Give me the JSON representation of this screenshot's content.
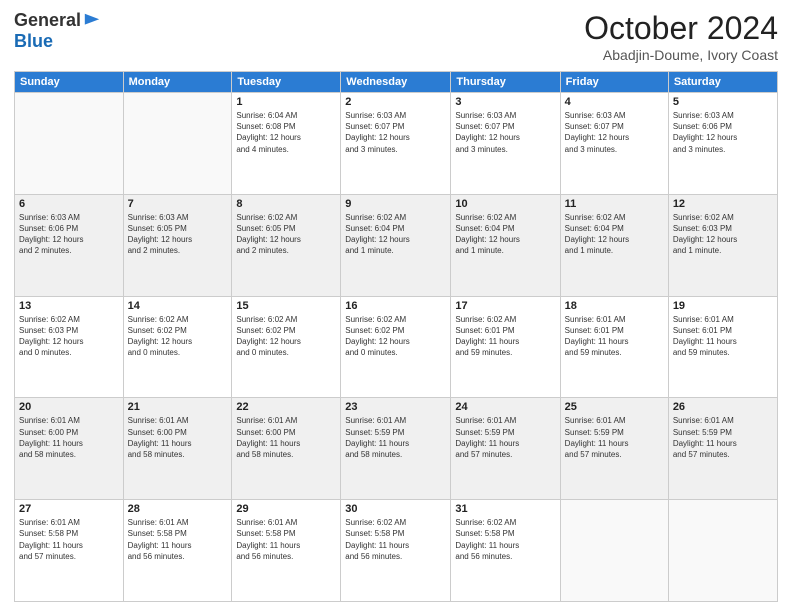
{
  "logo": {
    "general": "General",
    "blue": "Blue"
  },
  "header": {
    "month": "October 2024",
    "location": "Abadjin-Doume, Ivory Coast"
  },
  "weekdays": [
    "Sunday",
    "Monday",
    "Tuesday",
    "Wednesday",
    "Thursday",
    "Friday",
    "Saturday"
  ],
  "weeks": [
    [
      {
        "day": "",
        "info": ""
      },
      {
        "day": "",
        "info": ""
      },
      {
        "day": "1",
        "info": "Sunrise: 6:04 AM\nSunset: 6:08 PM\nDaylight: 12 hours\nand 4 minutes."
      },
      {
        "day": "2",
        "info": "Sunrise: 6:03 AM\nSunset: 6:07 PM\nDaylight: 12 hours\nand 3 minutes."
      },
      {
        "day": "3",
        "info": "Sunrise: 6:03 AM\nSunset: 6:07 PM\nDaylight: 12 hours\nand 3 minutes."
      },
      {
        "day": "4",
        "info": "Sunrise: 6:03 AM\nSunset: 6:07 PM\nDaylight: 12 hours\nand 3 minutes."
      },
      {
        "day": "5",
        "info": "Sunrise: 6:03 AM\nSunset: 6:06 PM\nDaylight: 12 hours\nand 3 minutes."
      }
    ],
    [
      {
        "day": "6",
        "info": "Sunrise: 6:03 AM\nSunset: 6:06 PM\nDaylight: 12 hours\nand 2 minutes."
      },
      {
        "day": "7",
        "info": "Sunrise: 6:03 AM\nSunset: 6:05 PM\nDaylight: 12 hours\nand 2 minutes."
      },
      {
        "day": "8",
        "info": "Sunrise: 6:02 AM\nSunset: 6:05 PM\nDaylight: 12 hours\nand 2 minutes."
      },
      {
        "day": "9",
        "info": "Sunrise: 6:02 AM\nSunset: 6:04 PM\nDaylight: 12 hours\nand 1 minute."
      },
      {
        "day": "10",
        "info": "Sunrise: 6:02 AM\nSunset: 6:04 PM\nDaylight: 12 hours\nand 1 minute."
      },
      {
        "day": "11",
        "info": "Sunrise: 6:02 AM\nSunset: 6:04 PM\nDaylight: 12 hours\nand 1 minute."
      },
      {
        "day": "12",
        "info": "Sunrise: 6:02 AM\nSunset: 6:03 PM\nDaylight: 12 hours\nand 1 minute."
      }
    ],
    [
      {
        "day": "13",
        "info": "Sunrise: 6:02 AM\nSunset: 6:03 PM\nDaylight: 12 hours\nand 0 minutes."
      },
      {
        "day": "14",
        "info": "Sunrise: 6:02 AM\nSunset: 6:02 PM\nDaylight: 12 hours\nand 0 minutes."
      },
      {
        "day": "15",
        "info": "Sunrise: 6:02 AM\nSunset: 6:02 PM\nDaylight: 12 hours\nand 0 minutes."
      },
      {
        "day": "16",
        "info": "Sunrise: 6:02 AM\nSunset: 6:02 PM\nDaylight: 12 hours\nand 0 minutes."
      },
      {
        "day": "17",
        "info": "Sunrise: 6:02 AM\nSunset: 6:01 PM\nDaylight: 11 hours\nand 59 minutes."
      },
      {
        "day": "18",
        "info": "Sunrise: 6:01 AM\nSunset: 6:01 PM\nDaylight: 11 hours\nand 59 minutes."
      },
      {
        "day": "19",
        "info": "Sunrise: 6:01 AM\nSunset: 6:01 PM\nDaylight: 11 hours\nand 59 minutes."
      }
    ],
    [
      {
        "day": "20",
        "info": "Sunrise: 6:01 AM\nSunset: 6:00 PM\nDaylight: 11 hours\nand 58 minutes."
      },
      {
        "day": "21",
        "info": "Sunrise: 6:01 AM\nSunset: 6:00 PM\nDaylight: 11 hours\nand 58 minutes."
      },
      {
        "day": "22",
        "info": "Sunrise: 6:01 AM\nSunset: 6:00 PM\nDaylight: 11 hours\nand 58 minutes."
      },
      {
        "day": "23",
        "info": "Sunrise: 6:01 AM\nSunset: 5:59 PM\nDaylight: 11 hours\nand 58 minutes."
      },
      {
        "day": "24",
        "info": "Sunrise: 6:01 AM\nSunset: 5:59 PM\nDaylight: 11 hours\nand 57 minutes."
      },
      {
        "day": "25",
        "info": "Sunrise: 6:01 AM\nSunset: 5:59 PM\nDaylight: 11 hours\nand 57 minutes."
      },
      {
        "day": "26",
        "info": "Sunrise: 6:01 AM\nSunset: 5:59 PM\nDaylight: 11 hours\nand 57 minutes."
      }
    ],
    [
      {
        "day": "27",
        "info": "Sunrise: 6:01 AM\nSunset: 5:58 PM\nDaylight: 11 hours\nand 57 minutes."
      },
      {
        "day": "28",
        "info": "Sunrise: 6:01 AM\nSunset: 5:58 PM\nDaylight: 11 hours\nand 56 minutes."
      },
      {
        "day": "29",
        "info": "Sunrise: 6:01 AM\nSunset: 5:58 PM\nDaylight: 11 hours\nand 56 minutes."
      },
      {
        "day": "30",
        "info": "Sunrise: 6:02 AM\nSunset: 5:58 PM\nDaylight: 11 hours\nand 56 minutes."
      },
      {
        "day": "31",
        "info": "Sunrise: 6:02 AM\nSunset: 5:58 PM\nDaylight: 11 hours\nand 56 minutes."
      },
      {
        "day": "",
        "info": ""
      },
      {
        "day": "",
        "info": ""
      }
    ]
  ]
}
